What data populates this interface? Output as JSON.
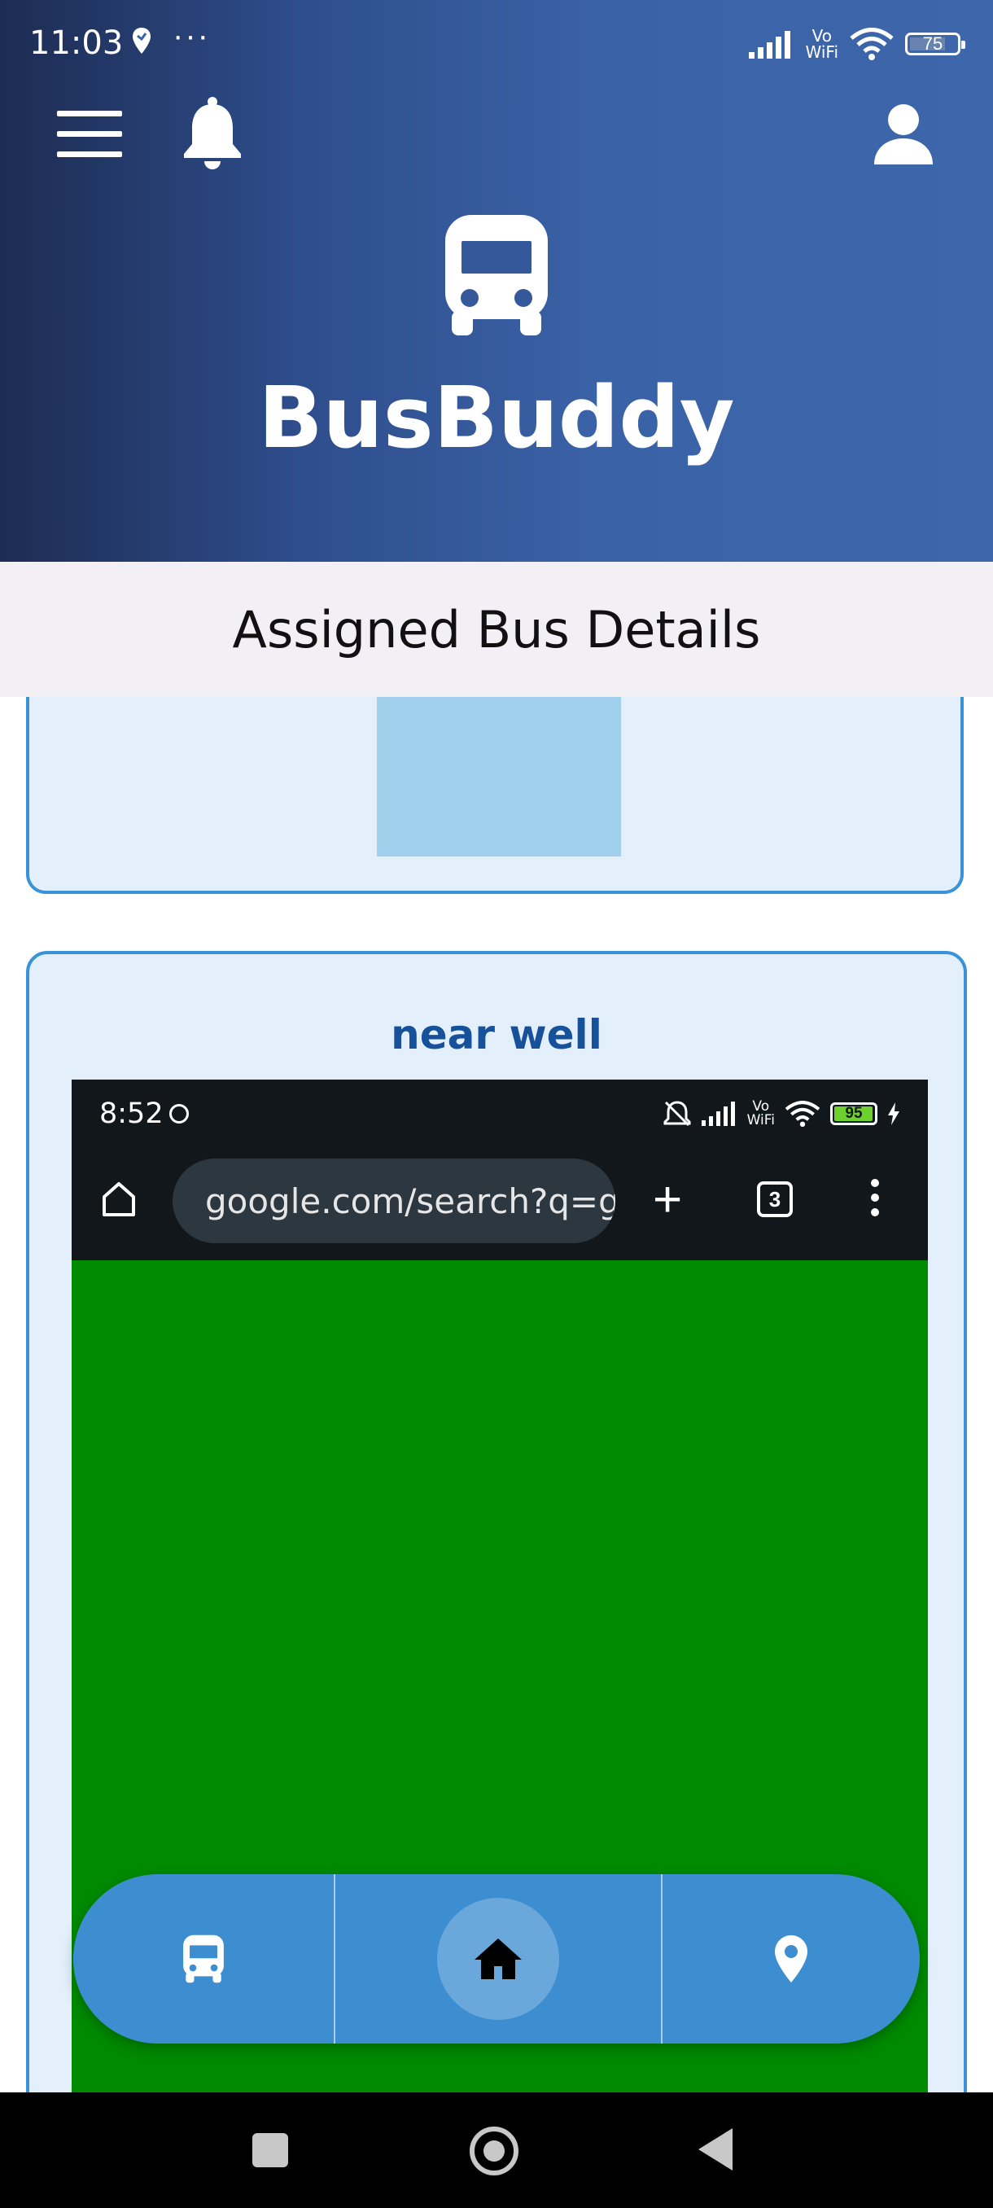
{
  "status_bar": {
    "time": "11:03",
    "dots": "···",
    "vowifi_top": "Vo",
    "vowifi_bottom": "WiFi",
    "battery": "75"
  },
  "header": {
    "app_title": "BusBuddy",
    "icons": [
      "menu-icon",
      "bell-icon",
      "user-icon",
      "bus-icon"
    ]
  },
  "section": {
    "title": "Assigned Bus Details"
  },
  "cards": [
    {
      "title": ""
    },
    {
      "title": "near well"
    }
  ],
  "embedded_screenshot": {
    "time": "8:52",
    "vowifi_top": "Vo",
    "vowifi_bottom": "WiFi",
    "battery": "95",
    "url": "google.com/search?q=g",
    "tab_count": "3",
    "plus": "+"
  },
  "bottom_nav": {
    "items": [
      {
        "name": "bus",
        "icon": "bus-icon"
      },
      {
        "name": "home",
        "icon": "home-icon",
        "active": true
      },
      {
        "name": "location",
        "icon": "location-pin-icon"
      }
    ]
  },
  "colors": {
    "header_gradient_start": "#1d2c52",
    "header_gradient_end": "#3e66aa",
    "card_border": "#3a93d8",
    "card_bg": "#e3f0fb",
    "card_title": "#17519a",
    "nav_bg": "#3d8ed0",
    "green_area": "#008a00"
  }
}
